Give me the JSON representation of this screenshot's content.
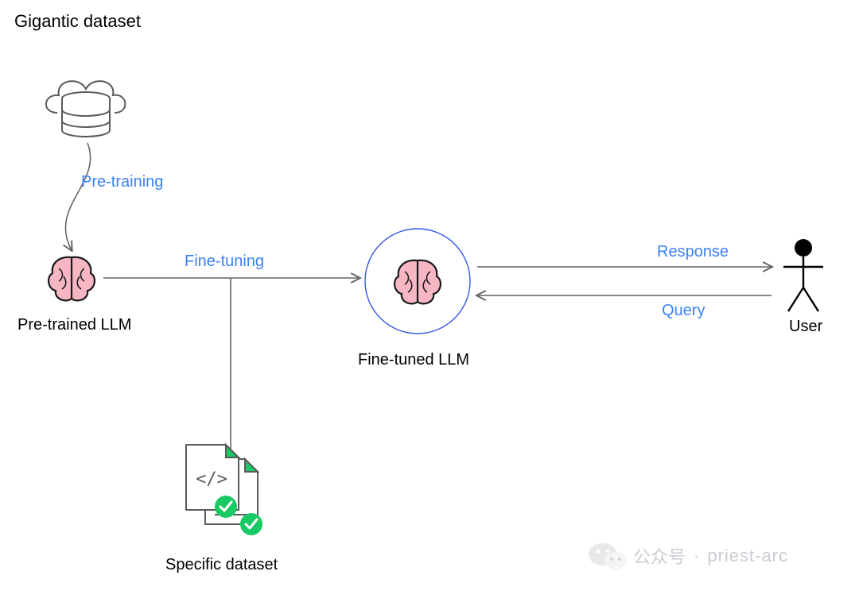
{
  "title": "Gigantic dataset",
  "labels": {
    "pretraining": "Pre-training",
    "finetuning": "Fine-tuning",
    "pretrained_llm": "Pre-trained LLM",
    "finetuned_llm": "Fine-tuned LLM",
    "specific_dataset": "Specific dataset",
    "response": "Response",
    "query": "Query",
    "user": "User"
  },
  "watermark": {
    "channel": "公众号",
    "separator": "·",
    "name": "priest-arc"
  },
  "colors": {
    "stroke": "#646464",
    "blue": "#3b82f6",
    "brainFill": "#f7b6c3",
    "brainStroke": "#1a1a1a",
    "docGreen": "#18c964",
    "circle": "#3555e6"
  },
  "chart_data": {
    "type": "flow-diagram",
    "nodes": [
      {
        "id": "gigantic_dataset",
        "label": "Gigantic dataset",
        "kind": "cloud-database"
      },
      {
        "id": "pretrained_llm",
        "label": "Pre-trained LLM",
        "kind": "brain"
      },
      {
        "id": "finetuned_llm",
        "label": "Fine-tuned LLM",
        "kind": "brain-in-circle"
      },
      {
        "id": "specific_dataset",
        "label": "Specific dataset",
        "kind": "code-documents"
      },
      {
        "id": "user",
        "label": "User",
        "kind": "stick-figure"
      }
    ],
    "edges": [
      {
        "from": "gigantic_dataset",
        "to": "pretrained_llm",
        "label": "Pre-training",
        "style": "curved-arrow"
      },
      {
        "from": "pretrained_llm",
        "to": "finetuned_llm",
        "label": "Fine-tuning",
        "style": "straight-arrow"
      },
      {
        "from": "specific_dataset",
        "to": "finetuning-edge",
        "label": null,
        "style": "merge-line"
      },
      {
        "from": "finetuned_llm",
        "to": "user",
        "label": "Response",
        "style": "straight-arrow"
      },
      {
        "from": "user",
        "to": "finetuned_llm",
        "label": "Query",
        "style": "straight-arrow"
      }
    ]
  }
}
